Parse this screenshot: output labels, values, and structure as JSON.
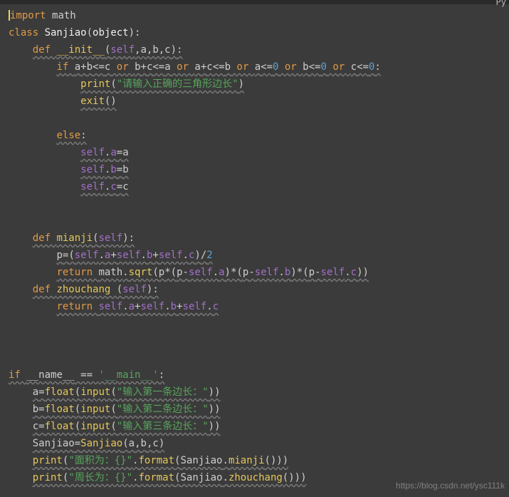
{
  "topbar": {
    "lang": "Py"
  },
  "code": {
    "lines": [
      [
        {
          "t": "import ",
          "c": "kw"
        },
        {
          "t": "math",
          "c": "mod"
        }
      ],
      [
        {
          "t": "class ",
          "c": "kw"
        },
        {
          "t": "Sanjiao",
          "c": "cls"
        },
        {
          "t": "(",
          "c": "op"
        },
        {
          "t": "object",
          "c": "cls"
        },
        {
          "t": ")",
          "c": "op"
        },
        {
          "t": ":",
          "c": "op"
        }
      ],
      [
        {
          "t": "    ",
          "c": ""
        },
        {
          "t": "def ",
          "c": "kw",
          "w": true
        },
        {
          "t": "__init__",
          "c": "fn",
          "w": true
        },
        {
          "t": "(",
          "c": "op",
          "w": true
        },
        {
          "t": "self",
          "c": "param",
          "w": true
        },
        {
          "t": ",a,b,c",
          "c": "op",
          "w": true
        },
        {
          "t": ")",
          "c": "op",
          "w": true
        },
        {
          "t": ":",
          "c": "op",
          "w": true
        }
      ],
      [
        {
          "t": "        ",
          "c": ""
        },
        {
          "t": "if ",
          "c": "kw",
          "w": true
        },
        {
          "t": "a",
          "c": "op",
          "w": true
        },
        {
          "t": "+",
          "c": "op",
          "w": true
        },
        {
          "t": "b",
          "c": "op",
          "w": true
        },
        {
          "t": "<=",
          "c": "op",
          "w": true
        },
        {
          "t": "c",
          "c": "op",
          "w": true
        },
        {
          "t": " or ",
          "c": "kw",
          "w": true
        },
        {
          "t": "b",
          "c": "op",
          "w": true
        },
        {
          "t": "+",
          "c": "op",
          "w": true
        },
        {
          "t": "c",
          "c": "op",
          "w": true
        },
        {
          "t": "<=",
          "c": "op",
          "w": true
        },
        {
          "t": "a",
          "c": "op",
          "w": true
        },
        {
          "t": " or ",
          "c": "kw",
          "w": true
        },
        {
          "t": "a",
          "c": "op",
          "w": true
        },
        {
          "t": "+",
          "c": "op",
          "w": true
        },
        {
          "t": "c",
          "c": "op",
          "w": true
        },
        {
          "t": "<=",
          "c": "op",
          "w": true
        },
        {
          "t": "b",
          "c": "op",
          "w": true
        },
        {
          "t": " or ",
          "c": "kw",
          "w": true
        },
        {
          "t": "a",
          "c": "op",
          "w": true
        },
        {
          "t": "<=",
          "c": "op",
          "w": true
        },
        {
          "t": "0",
          "c": "num",
          "w": true
        },
        {
          "t": " or ",
          "c": "kw",
          "w": true
        },
        {
          "t": "b",
          "c": "op",
          "w": true
        },
        {
          "t": "<=",
          "c": "op",
          "w": true
        },
        {
          "t": "0",
          "c": "num",
          "w": true
        },
        {
          "t": " or ",
          "c": "kw",
          "w": true
        },
        {
          "t": "c",
          "c": "op",
          "w": true
        },
        {
          "t": "<=",
          "c": "op",
          "w": true
        },
        {
          "t": "0",
          "c": "num",
          "w": true
        },
        {
          "t": ":",
          "c": "op",
          "w": true
        }
      ],
      [
        {
          "t": "            ",
          "c": ""
        },
        {
          "t": "print",
          "c": "fn",
          "w": true
        },
        {
          "t": "(",
          "c": "op",
          "w": true
        },
        {
          "t": "\"请输入正确的三角形边长\"",
          "c": "str",
          "w": true
        },
        {
          "t": ")",
          "c": "op",
          "w": true
        }
      ],
      [
        {
          "t": "            ",
          "c": ""
        },
        {
          "t": "exit",
          "c": "fn",
          "w": true
        },
        {
          "t": "()",
          "c": "op",
          "w": true
        }
      ],
      [],
      [
        {
          "t": "        ",
          "c": ""
        },
        {
          "t": "else",
          "c": "kw",
          "w": true
        },
        {
          "t": ":",
          "c": "op",
          "w": true
        }
      ],
      [
        {
          "t": "            ",
          "c": ""
        },
        {
          "t": "self",
          "c": "param",
          "w": true
        },
        {
          "t": ".",
          "c": "op",
          "w": true
        },
        {
          "t": "a",
          "c": "param",
          "w": true
        },
        {
          "t": "=",
          "c": "op",
          "w": true
        },
        {
          "t": "a",
          "c": "op",
          "w": true
        }
      ],
      [
        {
          "t": "            ",
          "c": ""
        },
        {
          "t": "self",
          "c": "param",
          "w": true
        },
        {
          "t": ".",
          "c": "op",
          "w": true
        },
        {
          "t": "b",
          "c": "param",
          "w": true
        },
        {
          "t": "=",
          "c": "op",
          "w": true
        },
        {
          "t": "b",
          "c": "op",
          "w": true
        }
      ],
      [
        {
          "t": "            ",
          "c": ""
        },
        {
          "t": "self",
          "c": "param",
          "w": true
        },
        {
          "t": ".",
          "c": "op",
          "w": true
        },
        {
          "t": "c",
          "c": "param",
          "w": true
        },
        {
          "t": "=",
          "c": "op",
          "w": true
        },
        {
          "t": "c",
          "c": "op",
          "w": true
        }
      ],
      [],
      [],
      [
        {
          "t": "    ",
          "c": ""
        },
        {
          "t": "def ",
          "c": "kw",
          "w": true
        },
        {
          "t": "mianji",
          "c": "fn",
          "w": true
        },
        {
          "t": "(",
          "c": "op",
          "w": true
        },
        {
          "t": "self",
          "c": "param",
          "w": true
        },
        {
          "t": ")",
          "c": "op",
          "w": true
        },
        {
          "t": ":",
          "c": "op",
          "w": true
        }
      ],
      [
        {
          "t": "        ",
          "c": ""
        },
        {
          "t": "p",
          "c": "op",
          "w": true
        },
        {
          "t": "=",
          "c": "op",
          "w": true
        },
        {
          "t": "(",
          "c": "op",
          "w": true
        },
        {
          "t": "self",
          "c": "param",
          "w": true
        },
        {
          "t": ".",
          "c": "op",
          "w": true
        },
        {
          "t": "a",
          "c": "param",
          "w": true
        },
        {
          "t": "+",
          "c": "op",
          "w": true
        },
        {
          "t": "self",
          "c": "param",
          "w": true
        },
        {
          "t": ".",
          "c": "op",
          "w": true
        },
        {
          "t": "b",
          "c": "param",
          "w": true
        },
        {
          "t": "+",
          "c": "op",
          "w": true
        },
        {
          "t": "self",
          "c": "param",
          "w": true
        },
        {
          "t": ".",
          "c": "op",
          "w": true
        },
        {
          "t": "c",
          "c": "param",
          "w": true
        },
        {
          "t": ")",
          "c": "op",
          "w": true
        },
        {
          "t": "/",
          "c": "op",
          "w": true
        },
        {
          "t": "2",
          "c": "num",
          "w": true
        }
      ],
      [
        {
          "t": "        ",
          "c": ""
        },
        {
          "t": "return ",
          "c": "kw",
          "w": true
        },
        {
          "t": "math",
          "c": "mod",
          "w": true
        },
        {
          "t": ".",
          "c": "op",
          "w": true
        },
        {
          "t": "sqrt",
          "c": "fn",
          "w": true
        },
        {
          "t": "(",
          "c": "op",
          "w": true
        },
        {
          "t": "p",
          "c": "op",
          "w": true
        },
        {
          "t": "*(",
          "c": "op",
          "w": true
        },
        {
          "t": "p",
          "c": "op",
          "w": true
        },
        {
          "t": "-",
          "c": "op",
          "w": true
        },
        {
          "t": "self",
          "c": "param",
          "w": true
        },
        {
          "t": ".",
          "c": "op",
          "w": true
        },
        {
          "t": "a",
          "c": "param",
          "w": true
        },
        {
          "t": ")*(",
          "c": "op",
          "w": true
        },
        {
          "t": "p",
          "c": "op",
          "w": true
        },
        {
          "t": "-",
          "c": "op",
          "w": true
        },
        {
          "t": "self",
          "c": "param",
          "w": true
        },
        {
          "t": ".",
          "c": "op",
          "w": true
        },
        {
          "t": "b",
          "c": "param",
          "w": true
        },
        {
          "t": ")*(",
          "c": "op",
          "w": true
        },
        {
          "t": "p",
          "c": "op",
          "w": true
        },
        {
          "t": "-",
          "c": "op",
          "w": true
        },
        {
          "t": "self",
          "c": "param",
          "w": true
        },
        {
          "t": ".",
          "c": "op",
          "w": true
        },
        {
          "t": "c",
          "c": "param",
          "w": true
        },
        {
          "t": "))",
          "c": "op",
          "w": true
        }
      ],
      [
        {
          "t": "    ",
          "c": ""
        },
        {
          "t": "def ",
          "c": "kw",
          "w": true
        },
        {
          "t": "zhouchang ",
          "c": "fn",
          "w": true
        },
        {
          "t": "(",
          "c": "op",
          "w": true
        },
        {
          "t": "self",
          "c": "param",
          "w": true
        },
        {
          "t": ")",
          "c": "op",
          "w": true
        },
        {
          "t": ":",
          "c": "op",
          "w": true
        }
      ],
      [
        {
          "t": "        ",
          "c": ""
        },
        {
          "t": "return ",
          "c": "kw",
          "w": true
        },
        {
          "t": "self",
          "c": "param",
          "w": true
        },
        {
          "t": ".",
          "c": "op",
          "w": true
        },
        {
          "t": "a",
          "c": "param",
          "w": true
        },
        {
          "t": "+",
          "c": "op",
          "w": true
        },
        {
          "t": "self",
          "c": "param",
          "w": true
        },
        {
          "t": ".",
          "c": "op",
          "w": true
        },
        {
          "t": "b",
          "c": "param",
          "w": true
        },
        {
          "t": "+",
          "c": "op",
          "w": true
        },
        {
          "t": "self",
          "c": "param",
          "w": true
        },
        {
          "t": ".",
          "c": "op",
          "w": true
        },
        {
          "t": "c",
          "c": "param",
          "w": true
        }
      ],
      [],
      [],
      [],
      [
        {
          "t": "if ",
          "c": "kw",
          "w": true
        },
        {
          "t": "__name__",
          "c": "op",
          "w": true
        },
        {
          "t": " == ",
          "c": "op",
          "w": true
        },
        {
          "t": "'__main__'",
          "c": "str",
          "w": true
        },
        {
          "t": ":",
          "c": "op",
          "w": true
        }
      ],
      [
        {
          "t": "    ",
          "c": ""
        },
        {
          "t": "a",
          "c": "op",
          "w": true
        },
        {
          "t": "=",
          "c": "op",
          "w": true
        },
        {
          "t": "float",
          "c": "fn",
          "w": true
        },
        {
          "t": "(",
          "c": "op",
          "w": true
        },
        {
          "t": "input",
          "c": "fn",
          "w": true
        },
        {
          "t": "(",
          "c": "op",
          "w": true
        },
        {
          "t": "\"输入第一条边长：\"",
          "c": "str",
          "w": true
        },
        {
          "t": "))",
          "c": "op",
          "w": true
        }
      ],
      [
        {
          "t": "    ",
          "c": ""
        },
        {
          "t": "b",
          "c": "op",
          "w": true
        },
        {
          "t": "=",
          "c": "op",
          "w": true
        },
        {
          "t": "float",
          "c": "fn",
          "w": true
        },
        {
          "t": "(",
          "c": "op",
          "w": true
        },
        {
          "t": "input",
          "c": "fn",
          "w": true
        },
        {
          "t": "(",
          "c": "op",
          "w": true
        },
        {
          "t": "\"输入第二条边长：\"",
          "c": "str",
          "w": true
        },
        {
          "t": "))",
          "c": "op",
          "w": true
        }
      ],
      [
        {
          "t": "    ",
          "c": ""
        },
        {
          "t": "c",
          "c": "op",
          "w": true
        },
        {
          "t": "=",
          "c": "op",
          "w": true
        },
        {
          "t": "float",
          "c": "fn",
          "w": true
        },
        {
          "t": "(",
          "c": "op",
          "w": true
        },
        {
          "t": "input",
          "c": "fn",
          "w": true
        },
        {
          "t": "(",
          "c": "op",
          "w": true
        },
        {
          "t": "\"输入第三条边长：\"",
          "c": "str",
          "w": true
        },
        {
          "t": "))",
          "c": "op",
          "w": true
        }
      ],
      [
        {
          "t": "    ",
          "c": ""
        },
        {
          "t": "Sanjiao",
          "c": "op",
          "w": true
        },
        {
          "t": "=",
          "c": "op",
          "w": true
        },
        {
          "t": "Sanjiao",
          "c": "fn",
          "w": true
        },
        {
          "t": "(",
          "c": "op",
          "w": true
        },
        {
          "t": "a",
          "c": "op",
          "w": true
        },
        {
          "t": ",",
          "c": "op",
          "w": true
        },
        {
          "t": "b",
          "c": "op",
          "w": true
        },
        {
          "t": ",",
          "c": "op",
          "w": true
        },
        {
          "t": "c",
          "c": "op",
          "w": true
        },
        {
          "t": ")",
          "c": "op",
          "w": true
        }
      ],
      [
        {
          "t": "    ",
          "c": ""
        },
        {
          "t": "print",
          "c": "fn",
          "w": true
        },
        {
          "t": "(",
          "c": "op",
          "w": true
        },
        {
          "t": "\"面积为：{}\"",
          "c": "str",
          "w": true
        },
        {
          "t": ".",
          "c": "op",
          "w": true
        },
        {
          "t": "format",
          "c": "fn",
          "w": true
        },
        {
          "t": "(",
          "c": "op",
          "w": true
        },
        {
          "t": "Sanjiao",
          "c": "op",
          "w": true
        },
        {
          "t": ".",
          "c": "op",
          "w": true
        },
        {
          "t": "mianji",
          "c": "fn",
          "w": true
        },
        {
          "t": "()))",
          "c": "op",
          "w": true
        }
      ],
      [
        {
          "t": "    ",
          "c": ""
        },
        {
          "t": "print",
          "c": "fn",
          "w": true
        },
        {
          "t": "(",
          "c": "op",
          "w": true
        },
        {
          "t": "\"周长为：{}\"",
          "c": "str",
          "w": true
        },
        {
          "t": ".",
          "c": "op",
          "w": true
        },
        {
          "t": "format",
          "c": "fn",
          "w": true
        },
        {
          "t": "(",
          "c": "op",
          "w": true
        },
        {
          "t": "Sanjiao",
          "c": "op",
          "w": true
        },
        {
          "t": ".",
          "c": "op",
          "w": true
        },
        {
          "t": "zhouchang",
          "c": "fn",
          "w": true
        },
        {
          "t": "()))",
          "c": "op",
          "w": true
        }
      ]
    ]
  },
  "watermark": "https://blog.csdn.net/ysc111k"
}
